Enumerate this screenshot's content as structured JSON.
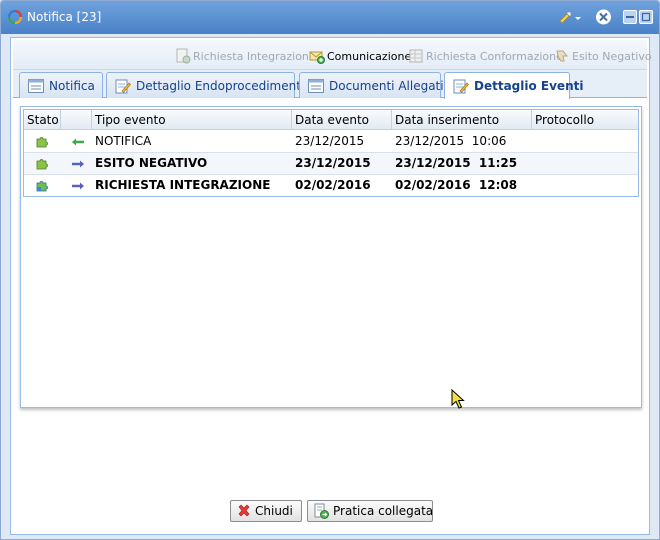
{
  "window": {
    "title": "Notifica [23]"
  },
  "toolbar": {
    "items": [
      {
        "label": "Richiesta Integrazione",
        "enabled": false
      },
      {
        "label": "Comunicazione",
        "enabled": true
      },
      {
        "label": "Richiesta Conformazione",
        "enabled": false
      },
      {
        "label": "Esito Negativo",
        "enabled": false
      }
    ]
  },
  "tabs": [
    {
      "label": "Notifica",
      "active": false
    },
    {
      "label": "Dettaglio Endoprocedimenti",
      "active": false
    },
    {
      "label": "Documenti Allegati",
      "active": false
    },
    {
      "label": "Dettaglio Eventi",
      "active": true
    }
  ],
  "grid": {
    "columns": [
      "Stato",
      "",
      "Tipo evento",
      "Data evento",
      "Data inserimento",
      "Protocollo"
    ],
    "rows": [
      {
        "direction": "in",
        "tipo": "NOTIFICA",
        "data_evento": "23/12/2015",
        "data_inserimento": "23/12/2015  10:06",
        "protocollo": "",
        "bold": false
      },
      {
        "direction": "out",
        "tipo": "ESITO NEGATIVO",
        "data_evento": "23/12/2015",
        "data_inserimento": "23/12/2015  11:25",
        "protocollo": "",
        "bold": true
      },
      {
        "direction": "out",
        "tipo": "RICHIESTA INTEGRAZIONE",
        "data_evento": "02/02/2016",
        "data_inserimento": "02/02/2016  12:08",
        "protocollo": "",
        "bold": true
      }
    ]
  },
  "buttons": {
    "close_label": "Chiudi",
    "linked_label": "Pratica collegata"
  },
  "colors": {
    "titlebar": "#4a82c8",
    "tab_text": "#15428b",
    "border": "#99bbe8",
    "arrow_in": "#3aa84a",
    "arrow_out": "#5a62b8"
  }
}
